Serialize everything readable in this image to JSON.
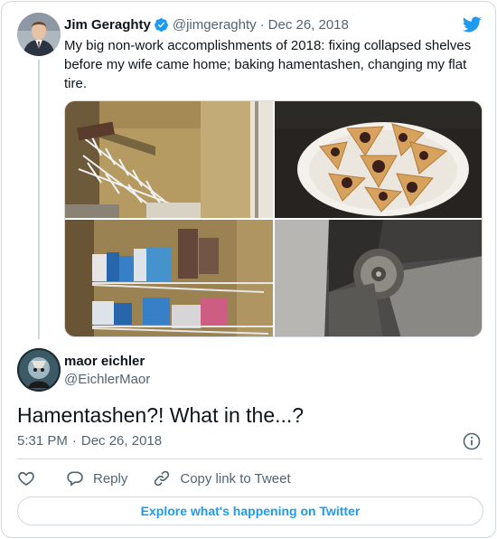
{
  "parent_tweet": {
    "author_name": "Jim Geraghty",
    "author_handle": "@jimgeraghty",
    "separator": "·",
    "date": "Dec 26, 2018",
    "text": "My big non-work accomplishments of 2018: fixing collapsed shelves before my wife came home; baking hamentashen, changing my flat tire.",
    "verified_icon": "verified-badge-icon",
    "logo_icon": "twitter-bird-icon"
  },
  "media": {
    "photos": [
      "collapsed-shelves-photo",
      "hamentashen-photo",
      "fixed-shelves-photo",
      "flat-tire-photo"
    ]
  },
  "reply_tweet": {
    "author_name": "maor eichler",
    "author_handle": "@EichlerMaor",
    "text": "Hamentashen?! What in the...?",
    "time": "5:31 PM",
    "separator": "·",
    "date": "Dec 26, 2018",
    "info_icon": "info-icon"
  },
  "actions": {
    "like_icon": "heart-icon",
    "reply_label": "Reply",
    "copy_link_label": "Copy link to Tweet"
  },
  "explore_label": "Explore what's happening on Twitter",
  "colors": {
    "accent": "#1d9bf0",
    "text": "#0f1419",
    "secondary_text": "#536471",
    "border": "#cfd9de"
  }
}
